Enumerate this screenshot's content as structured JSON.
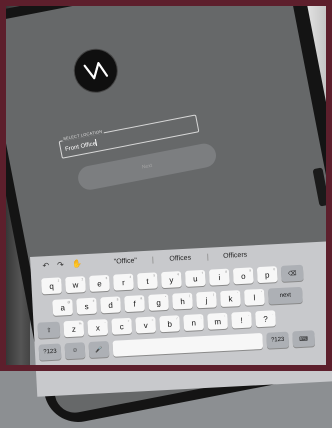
{
  "status": {
    "icons": "▴ ◈ ▮"
  },
  "login": {
    "field_label": "SELECT LOCATION",
    "field_value": "Front Office",
    "next_label": "Next"
  },
  "keyboard": {
    "toolbar": {
      "undo_icon": "↶",
      "redo_icon": "↷",
      "paste_icon": "✋"
    },
    "suggestions": [
      "\"Office\"",
      "Offices",
      "Officers"
    ],
    "row1": [
      {
        "k": "q",
        "h": "1"
      },
      {
        "k": "w",
        "h": "2"
      },
      {
        "k": "e",
        "h": "3"
      },
      {
        "k": "r",
        "h": "4"
      },
      {
        "k": "t",
        "h": "5"
      },
      {
        "k": "y",
        "h": "6"
      },
      {
        "k": "u",
        "h": "7"
      },
      {
        "k": "i",
        "h": "8"
      },
      {
        "k": "o",
        "h": "9"
      },
      {
        "k": "p",
        "h": "0"
      }
    ],
    "delete_icon": "⌫",
    "row2": [
      {
        "k": "a",
        "h": "@"
      },
      {
        "k": "s",
        "h": "#"
      },
      {
        "k": "d",
        "h": "$"
      },
      {
        "k": "f",
        "h": "&"
      },
      {
        "k": "g",
        "h": "*"
      },
      {
        "k": "h",
        "h": "("
      },
      {
        "k": "j",
        "h": ")"
      },
      {
        "k": "k",
        "h": "'"
      },
      {
        "k": "l",
        "h": "\""
      }
    ],
    "next_key": "next",
    "shift_icon": "⇧",
    "row3": [
      {
        "k": "z",
        "h": "%"
      },
      {
        "k": "x",
        "h": "-"
      },
      {
        "k": "c",
        "h": "+"
      },
      {
        "k": "v",
        "h": "="
      },
      {
        "k": "b",
        "h": "/"
      },
      {
        "k": "n",
        "h": ";"
      },
      {
        "k": "m",
        "h": ":"
      },
      {
        "k": "!",
        "h": ","
      },
      {
        "k": "?",
        "h": "."
      }
    ],
    "numbers_key": "?123",
    "emoji_icon": "☺",
    "mic_icon": "🎤",
    "hide_icon": "⌨"
  }
}
